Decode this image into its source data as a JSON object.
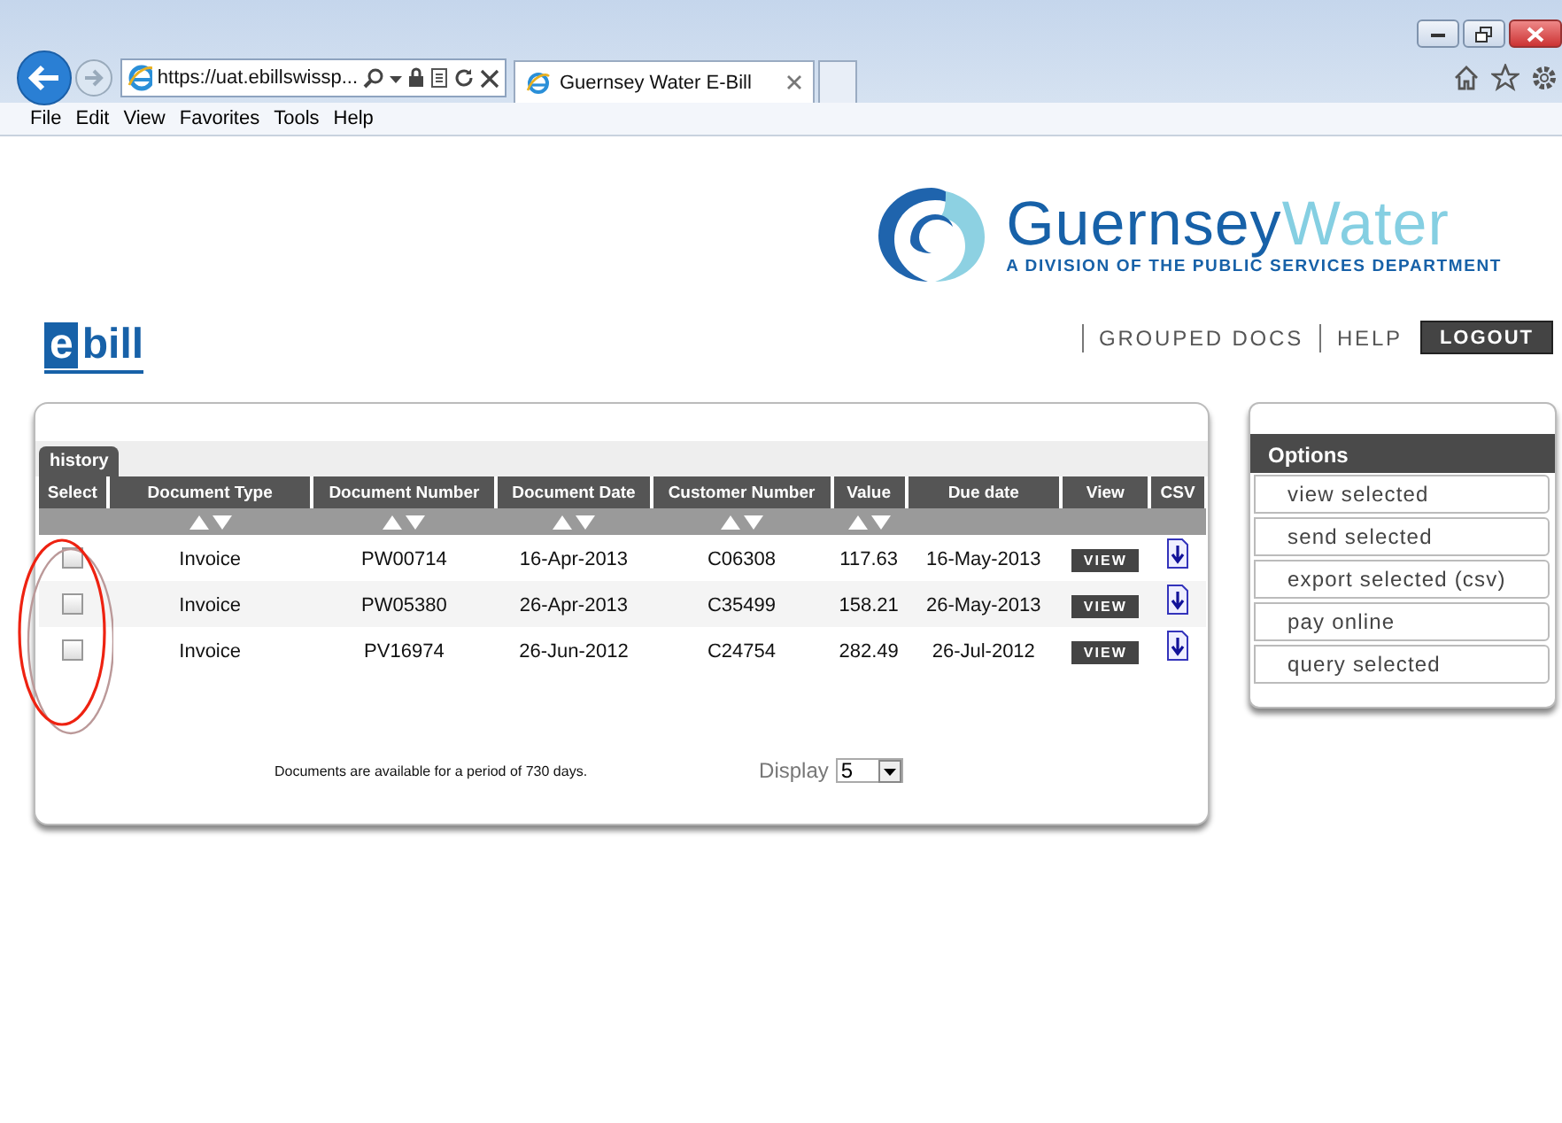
{
  "browser": {
    "address": "https://uat.ebillswissp...",
    "tabs": [
      {
        "title": "Guernsey Water E-Bill",
        "selected": true
      }
    ],
    "menu": [
      "File",
      "Edit",
      "View",
      "Favorites",
      "Tools",
      "Help"
    ]
  },
  "brand": {
    "words": [
      "Guernsey",
      "Water"
    ],
    "tagline": "A DIVISION OF THE PUBLIC SERVICES DEPARTMENT"
  },
  "ebill": {
    "mark": "e",
    "word": "bill"
  },
  "nav": {
    "links": [
      "GROUPED DOCS",
      "HELP"
    ],
    "button": "LOGOUT"
  },
  "history": {
    "tab": {
      "label": "history",
      "selected": true
    },
    "columns": [
      {
        "label": "Select",
        "sortable": false,
        "kind": "checkbox"
      },
      {
        "label": "Document Type",
        "sortable": true,
        "kind": "text"
      },
      {
        "label": "Document Number",
        "sortable": true,
        "kind": "text"
      },
      {
        "label": "Document Date",
        "sortable": true,
        "kind": "text"
      },
      {
        "label": "Customer Number",
        "sortable": true,
        "kind": "text"
      },
      {
        "label": "Value",
        "sortable": true,
        "kind": "text"
      },
      {
        "label": "Due date",
        "sortable": false,
        "kind": "text"
      },
      {
        "label": "View",
        "sortable": false,
        "kind": "button"
      },
      {
        "label": "CSV",
        "sortable": false,
        "kind": "download"
      }
    ],
    "rows": [
      {
        "checked": false,
        "cells": [
          "",
          "Invoice",
          "PW00714",
          "16-Apr-2013",
          "C06308",
          "117.63",
          "16-May-2013",
          "VIEW",
          ""
        ]
      },
      {
        "checked": false,
        "cells": [
          "",
          "Invoice",
          "PW05380",
          "26-Apr-2013",
          "C35499",
          "158.21",
          "26-May-2013",
          "VIEW",
          ""
        ]
      },
      {
        "checked": false,
        "cells": [
          "",
          "Invoice",
          "PV16974",
          "26-Jun-2012",
          "C24754",
          "282.49",
          "26-Jul-2012",
          "VIEW",
          ""
        ]
      }
    ],
    "note": "Documents are available for a period of 730 days.",
    "display": {
      "label": "Display",
      "value": "5"
    }
  },
  "options": {
    "title": "Options",
    "items": [
      "view selected",
      "send selected",
      "export selected (csv)",
      "pay online",
      "query selected"
    ]
  }
}
